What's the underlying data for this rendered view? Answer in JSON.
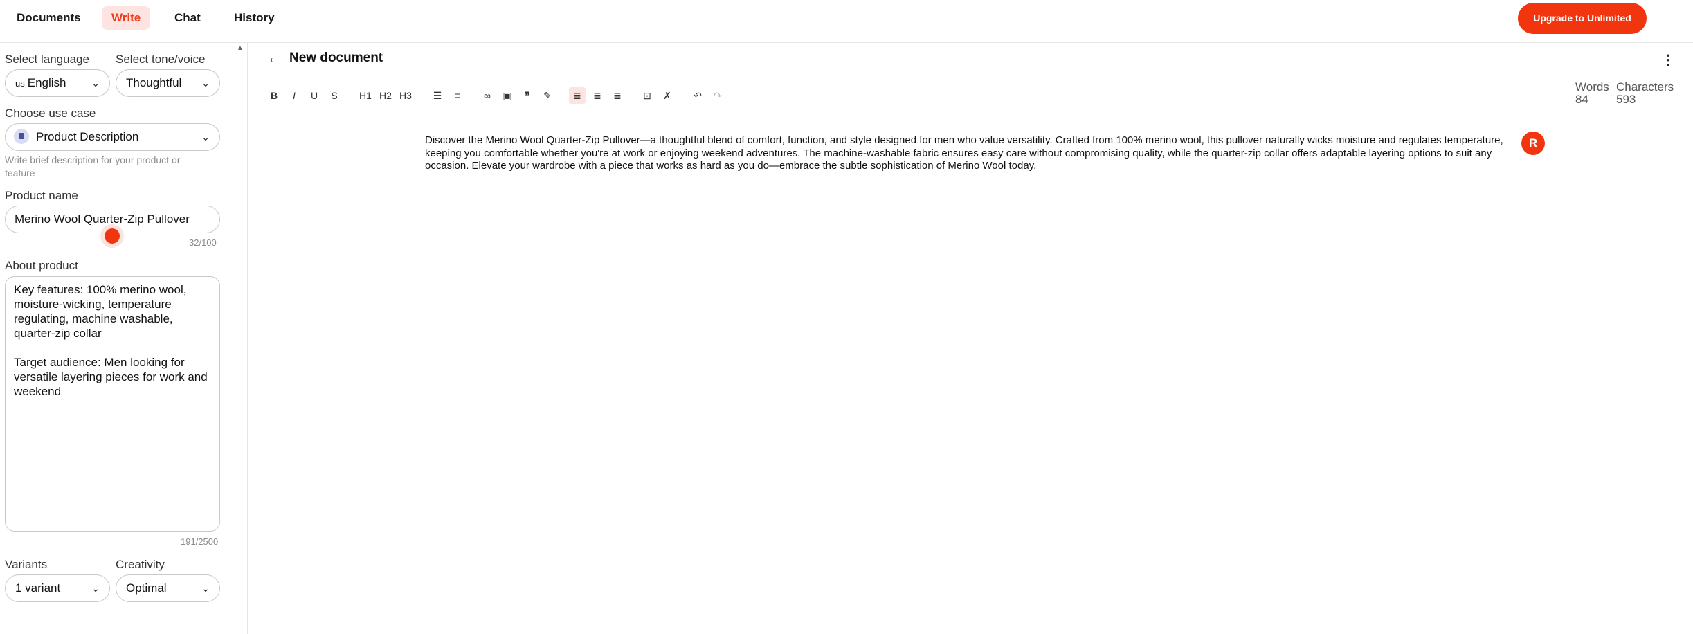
{
  "nav": {
    "tabs": [
      {
        "label": "Documents"
      },
      {
        "label": "Write"
      },
      {
        "label": "Chat"
      },
      {
        "label": "History"
      }
    ],
    "active_tab": "Write",
    "upgrade_label": "Upgrade to Unlimited"
  },
  "sidebar": {
    "language_label": "Select language",
    "language_flag": "us",
    "language_value": "English",
    "tone_label": "Select tone/voice",
    "tone_value": "Thoughtful",
    "usecase_label": "Choose use case",
    "usecase_value": "Product Description",
    "usecase_hint": "Write brief description for your product or feature",
    "product_name_label": "Product name",
    "product_name_value": "Merino Wool Quarter-Zip Pullover",
    "product_name_count": "32/100",
    "about_label": "About product",
    "about_value": "Key features: 100% merino wool, moisture-wicking, temperature regulating, machine washable, quarter-zip collar\n\nTarget audience: Men looking for versatile layering pieces for work and weekend",
    "about_count": "191/2500",
    "variants_label": "Variants",
    "variants_value": "1 variant",
    "creativity_label": "Creativity",
    "creativity_value": "Optimal"
  },
  "editor": {
    "title": "New document",
    "toolbar": {
      "bold": "B",
      "italic": "I",
      "underline": "U",
      "strike": "S",
      "h1": "H1",
      "h2": "H2",
      "h3": "H3"
    },
    "words_label": "Words",
    "words_value": "84",
    "characters_label": "Characters",
    "characters_value": "593",
    "body": "Discover the Merino Wool Quarter-Zip Pullover—a thoughtful blend of comfort, function, and style designed for men who value versatility. Crafted from 100% merino wool, this pullover naturally wicks moisture and regulates temperature, keeping you comfortable whether you're at work or enjoying weekend adventures. The machine-washable fabric ensures easy care without compromising quality, while the quarter-zip collar offers adaptable layering options to suit any occasion. Elevate your wardrobe with a piece that works as hard as you do—embrace the subtle sophistication of Merino Wool today.",
    "avatar_letter": "R"
  },
  "colors": {
    "accent": "#f1360f",
    "accent_soft": "#fde4e0"
  }
}
